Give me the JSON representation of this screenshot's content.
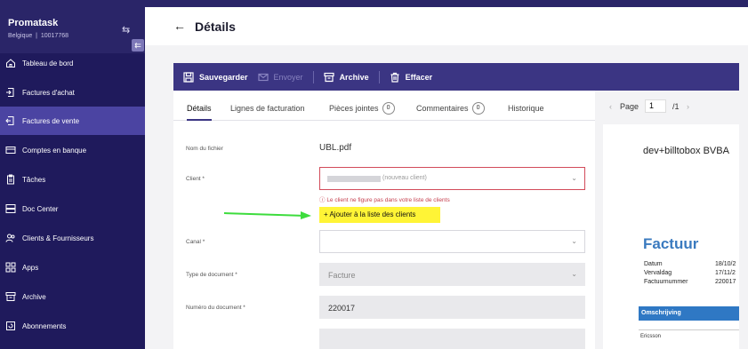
{
  "brand": {
    "name": "Promatask",
    "country": "Belgique",
    "separator": "|",
    "id": "10017768"
  },
  "sidebar": {
    "items": [
      {
        "label": "Tableau de bord",
        "icon": "home-icon"
      },
      {
        "label": "Factures d'achat",
        "icon": "invoice-in-icon"
      },
      {
        "label": "Factures de vente",
        "icon": "invoice-out-icon",
        "active": true
      },
      {
        "label": "Comptes en banque",
        "icon": "bank-card-icon"
      },
      {
        "label": "Tâches",
        "icon": "clipboard-icon"
      },
      {
        "label": "Doc Center",
        "icon": "doc-center-icon"
      },
      {
        "label": "Clients & Fournisseurs",
        "icon": "people-icon"
      },
      {
        "label": "Apps",
        "icon": "apps-icon"
      },
      {
        "label": "Archive",
        "icon": "archive-icon"
      },
      {
        "label": "Abonnements",
        "icon": "subscription-icon"
      }
    ]
  },
  "header": {
    "back": "←",
    "title": "Détails"
  },
  "toolbar": {
    "save": "Sauvegarder",
    "send": "Envoyer",
    "archive": "Archive",
    "delete": "Effacer"
  },
  "tabs": {
    "details": "Détails",
    "lines": "Lignes de facturation",
    "attachments": "Pièces jointes",
    "attachments_count": "0",
    "comments": "Commentaires",
    "comments_count": "0",
    "history": "Historique"
  },
  "form": {
    "filename_label": "Nom du fichier",
    "filename_value": "UBL.pdf",
    "client_label": "Client *",
    "client_placeholder": "(nouveau client)",
    "client_error": "Le client ne figure pas dans votre liste de clients",
    "add_client": "+ Ajouter à la liste des clients",
    "canal_label": "Canal *",
    "doctype_label": "Type de document *",
    "doctype_value": "Facture",
    "docnum_label": "Numéro du document *",
    "docnum_value": "220017"
  },
  "preview": {
    "page_label": "Page",
    "page_current": "1",
    "page_total": "/1",
    "company": "dev+billtobox BVBA",
    "doc_title": "Factuur",
    "rows": [
      {
        "label": "Datum",
        "value": "18/10/2"
      },
      {
        "label": "Vervaldag",
        "value": "17/11/2"
      },
      {
        "label": "Factuurnummer",
        "value": "220017"
      }
    ],
    "table_header": "Omschrijving",
    "footer_text": "Ericsson"
  },
  "colors": {
    "sidebar": "#1f1a5c",
    "sidebar_active": "#4b44a2",
    "toolbar": "#3b3583",
    "highlight": "#fff436",
    "error": "#d24b5a",
    "doc_accent": "#2f78c4"
  }
}
